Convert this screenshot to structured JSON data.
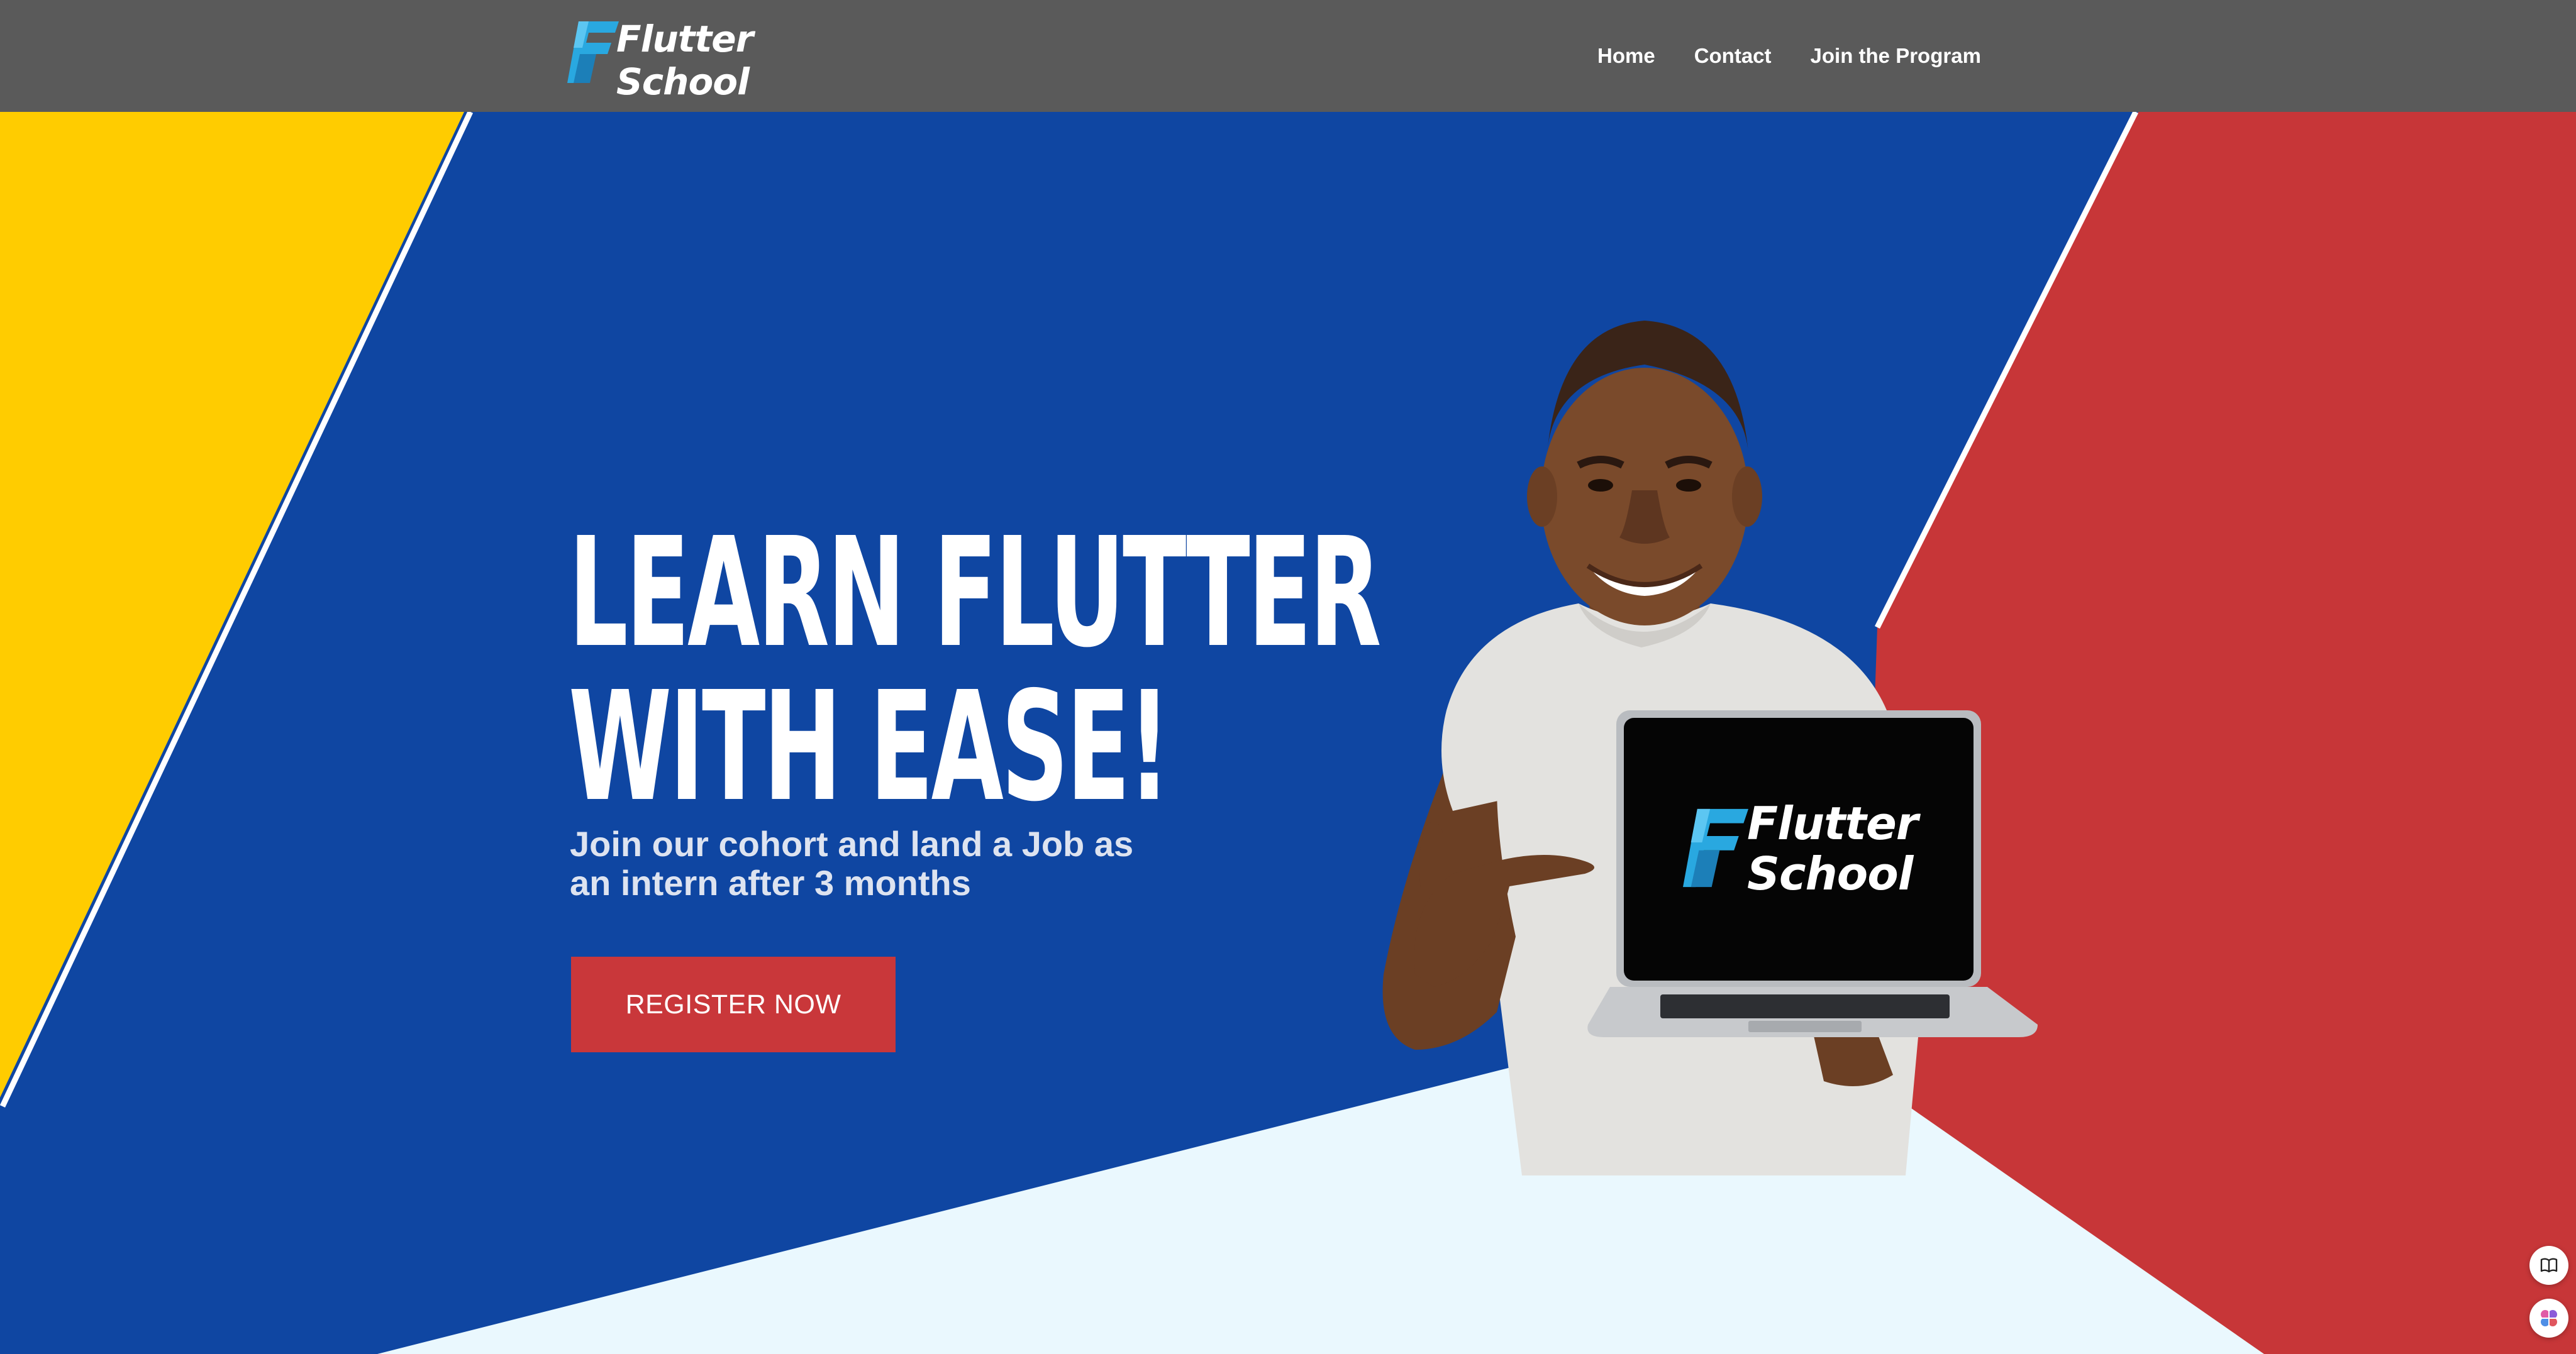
{
  "header": {
    "logo": {
      "line1": "Flutter",
      "line2": "School"
    },
    "nav": [
      {
        "label": "Home"
      },
      {
        "label": "Contact"
      },
      {
        "label": "Join the Program"
      }
    ]
  },
  "hero": {
    "headline": {
      "line1": "LEARN FLUTTER",
      "line2": "WITH EASE!"
    },
    "subtitle": "Join our cohort and land a Job as an intern after 3 months",
    "cta_label": "REGISTER NOW",
    "laptop_logo": {
      "line1": "Flutter",
      "line2": "School"
    }
  },
  "widgets": {
    "book_icon": "book-icon",
    "brain_icon": "brain-icon"
  },
  "colors": {
    "nav_bg": "#5a5a5a",
    "hero_blue": "#0f46a2",
    "accent_yellow": "#ffcc00",
    "accent_red": "#c73638",
    "light_panel": "#eaf8fe",
    "cta_red": "#c9373a",
    "logo_cyan": "#29a8e0"
  }
}
